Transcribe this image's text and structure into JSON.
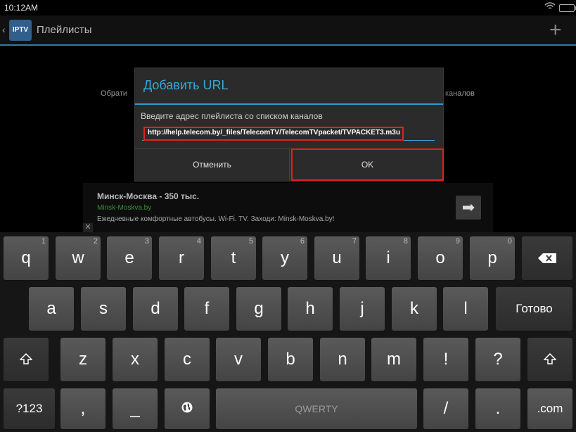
{
  "status_bar": {
    "time": "10:12AM"
  },
  "action_bar": {
    "app_icon_label": "IPTV",
    "title": "Плейлисты"
  },
  "background": {
    "left_fragment": "Обрати",
    "right_fragment": "каналов"
  },
  "dialog": {
    "title": "Добавить URL",
    "message": "Введите адрес плейлиста со списком каналов",
    "url_value": "http://help.telecom.by/_files/TelecomTV/TelecomTVpacket/TVPACKET3.m3u",
    "cancel_label": "Отменить",
    "ok_label": "OK"
  },
  "ad": {
    "title": "Минск-Москва - 350 тыс.",
    "url": "Minsk-Moskva.by",
    "text": "Ежедневные комфортные автобусы. Wi-Fi. TV. Заходи: Minsk-Moskva.by!",
    "close_label": "✕"
  },
  "keyboard": {
    "row1": [
      {
        "label": "q",
        "num": "1"
      },
      {
        "label": "w",
        "num": "2"
      },
      {
        "label": "e",
        "num": "3"
      },
      {
        "label": "r",
        "num": "4"
      },
      {
        "label": "t",
        "num": "5"
      },
      {
        "label": "y",
        "num": "6"
      },
      {
        "label": "u",
        "num": "7"
      },
      {
        "label": "i",
        "num": "8"
      },
      {
        "label": "o",
        "num": "9"
      },
      {
        "label": "p",
        "num": "0"
      }
    ],
    "row2": [
      "a",
      "s",
      "d",
      "f",
      "g",
      "h",
      "j",
      "k",
      "l"
    ],
    "row3": [
      "z",
      "x",
      "c",
      "v",
      "b",
      "n",
      "m",
      "!",
      "?"
    ],
    "done_label": "Готово",
    "symbols_label": "?123",
    "comma_label": ",",
    "underscore_label": "_",
    "space_label": "QWERTY",
    "slash_label": "/",
    "period_label": ".",
    "dotcom_label": ".com"
  }
}
